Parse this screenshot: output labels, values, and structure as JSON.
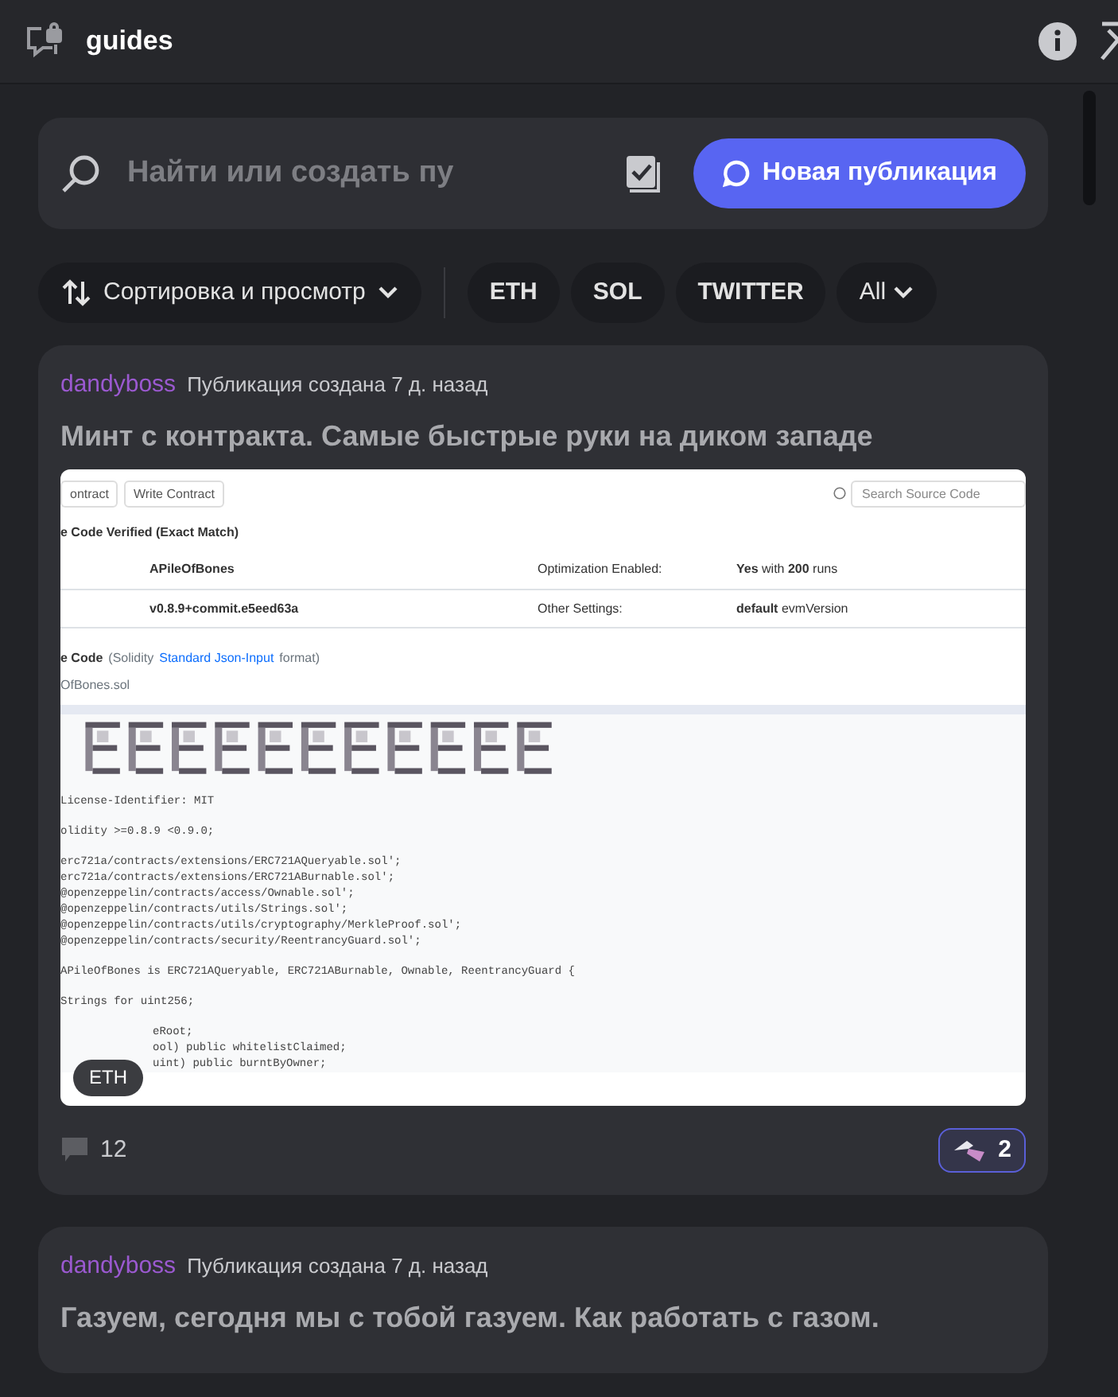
{
  "header": {
    "title": "guides"
  },
  "search": {
    "placeholder": "Найти или создать пу",
    "button": "Новая публикация"
  },
  "filters": {
    "sort": "Сортировка и просмотр",
    "tags": [
      {
        "label": "ETH",
        "kind": "tag"
      },
      {
        "label": "SOL",
        "kind": "tag"
      },
      {
        "label": "TWITTER",
        "kind": "tag"
      },
      {
        "label": "All",
        "kind": "dropdown"
      }
    ]
  },
  "posts": [
    {
      "author": "dandyboss",
      "meta": "Публикация создана 7 д. назад",
      "title": "Минт с контракта. Самые быстрые руки на диком западе",
      "image": {
        "buttons": [
          "ontract",
          "Write Contract"
        ],
        "search_placeholder": "Search Source Code",
        "verified": "e Code Verified (Exact Match)",
        "rows": [
          [
            "APileOfBones",
            "Optimization Enabled:",
            "**Yes** with **200** runs"
          ],
          [
            "v0.8.9+commit.e5eed63a",
            "Other Settings:",
            "**default** evmVersion"
          ]
        ],
        "source_heading": "e Code",
        "source_note_pre": "(Solidity",
        "source_link": "Standard Json-Input",
        "source_note_post": "format)",
        "file": "OfBones.sol",
        "code": [
          [
            "License-Identifier: MIT"
          ],
          [
            "olidity >=0.8.9 <0.9.0;"
          ],
          [
            "erc721a/contracts/extensions/ERC721AQueryable.sol';",
            "erc721a/contracts/extensions/ERC721ABurnable.sol';",
            "@openzeppelin/contracts/access/Ownable.sol';",
            "@openzeppelin/contracts/utils/Strings.sol';",
            "@openzeppelin/contracts/utils/cryptography/MerkleProof.sol';",
            "@openzeppelin/contracts/security/ReentrancyGuard.sol';"
          ],
          [
            "APileOfBones is ERC721AQueryable, ERC721ABurnable, Ownable, ReentrancyGuard {"
          ],
          [
            "Strings for uint256;"
          ]
        ],
        "code_covered": [
          "eRoot;",
          "ool) public whitelistClaimed;",
          "uint) public burntByOwner;"
        ],
        "tag": "ETH"
      },
      "comments": "12",
      "reactions": "2"
    },
    {
      "author": "dandyboss",
      "meta": "Публикация создана 7 д. назад",
      "title": "Газуем, сегодня мы с тобой газуем. Как работать с газом."
    }
  ]
}
